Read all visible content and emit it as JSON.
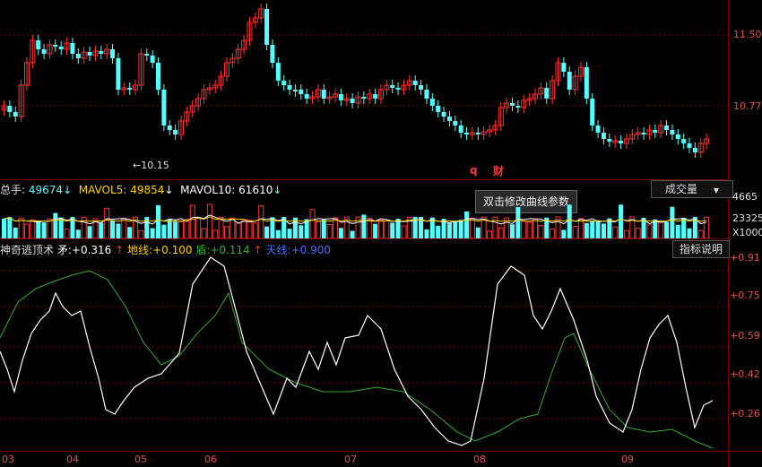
{
  "price_axis": {
    "labels": [
      "11.50",
      "10.77"
    ]
  },
  "min_marker": "10.15",
  "markers": {
    "q": "q",
    "cai": "财"
  },
  "volume_info": {
    "total_label": "总手:",
    "total_value": "49674",
    "mavol5_label": "MAVOL5:",
    "mavol5_value": "49854",
    "mavol10_label": "MAVOL10:",
    "mavol10_value": "61610",
    "arrow": "↓"
  },
  "volume_selector": {
    "label": "成交量",
    "caret": "▼"
  },
  "volume_axis": {
    "labels": [
      "4665",
      "23325",
      "X1000"
    ]
  },
  "tooltip": "双击修改曲线参数",
  "indicator_info": {
    "name": "神奇逃顶术",
    "mao_label": "矛:",
    "mao_value": "+0.316",
    "mao_arrow": "↑",
    "di_label": "地线:",
    "di_value": "+0.100",
    "dun_label": "盾:",
    "dun_value": "+0.114",
    "dun_arrow": "↑",
    "tian_label": "天线:",
    "tian_value": "+0.900"
  },
  "indicator_button": "指标说明",
  "indicator_axis": {
    "labels": [
      "+0.91",
      "+0.75",
      "+0.59",
      "+0.42",
      "+0.26"
    ]
  },
  "dates": [
    "03",
    "04",
    "05",
    "06",
    "07",
    "08",
    "09"
  ],
  "colors": {
    "up": "#ff3232",
    "down": "#54ffff",
    "mavol5": "#ffffff",
    "mavol10": "#ffd200",
    "mao": "#ffffff",
    "dun": "#33aa33",
    "axis": "#e05050",
    "grid": "#7a0000"
  },
  "chart_data": {
    "type": "line",
    "series": [
      {
        "name": "矛",
        "last": 0.316
      },
      {
        "name": "盾",
        "last": 0.114
      },
      {
        "name": "地线",
        "value": 0.1
      },
      {
        "name": "天线",
        "value": 0.9
      }
    ],
    "ylim": [
      0.1,
      0.95
    ]
  }
}
